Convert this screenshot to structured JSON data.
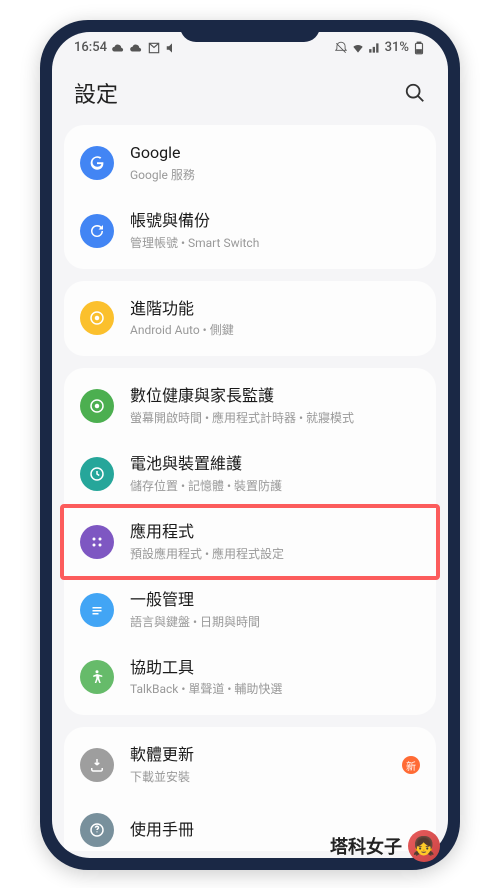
{
  "status": {
    "time": "16:54",
    "battery": "31%"
  },
  "header": {
    "title": "設定"
  },
  "groups": [
    {
      "items": [
        {
          "id": "google",
          "icon": "google",
          "title": "Google",
          "subtitle": "Google 服務"
        },
        {
          "id": "backup",
          "icon": "backup",
          "title": "帳號與備份",
          "subtitle": "管理帳號 • Smart Switch"
        }
      ]
    },
    {
      "items": [
        {
          "id": "advanced",
          "icon": "advanced",
          "title": "進階功能",
          "subtitle": "Android Auto • 側鍵"
        }
      ]
    },
    {
      "items": [
        {
          "id": "wellbeing",
          "icon": "wellbeing",
          "title": "數位健康與家長監護",
          "subtitle": "螢幕開啟時間 • 應用程式計時器 • 就寢模式"
        },
        {
          "id": "battery",
          "icon": "battery",
          "title": "電池與裝置維護",
          "subtitle": "儲存位置 • 記憶體 • 裝置防護"
        },
        {
          "id": "apps",
          "icon": "apps",
          "title": "應用程式",
          "subtitle": "預設應用程式 • 應用程式設定",
          "highlight": true
        },
        {
          "id": "general",
          "icon": "general",
          "title": "一般管理",
          "subtitle": "語言與鍵盤 • 日期與時間"
        },
        {
          "id": "accessibility",
          "icon": "accessibility",
          "title": "協助工具",
          "subtitle": "TalkBack • 單聲道 • 輔助快選"
        }
      ]
    },
    {
      "items": [
        {
          "id": "update",
          "icon": "update",
          "title": "軟體更新",
          "subtitle": "下載並安裝",
          "badge": "新"
        },
        {
          "id": "manual",
          "icon": "manual",
          "title": "使用手冊",
          "subtitle": ""
        }
      ]
    }
  ],
  "watermark": "塔科女子"
}
